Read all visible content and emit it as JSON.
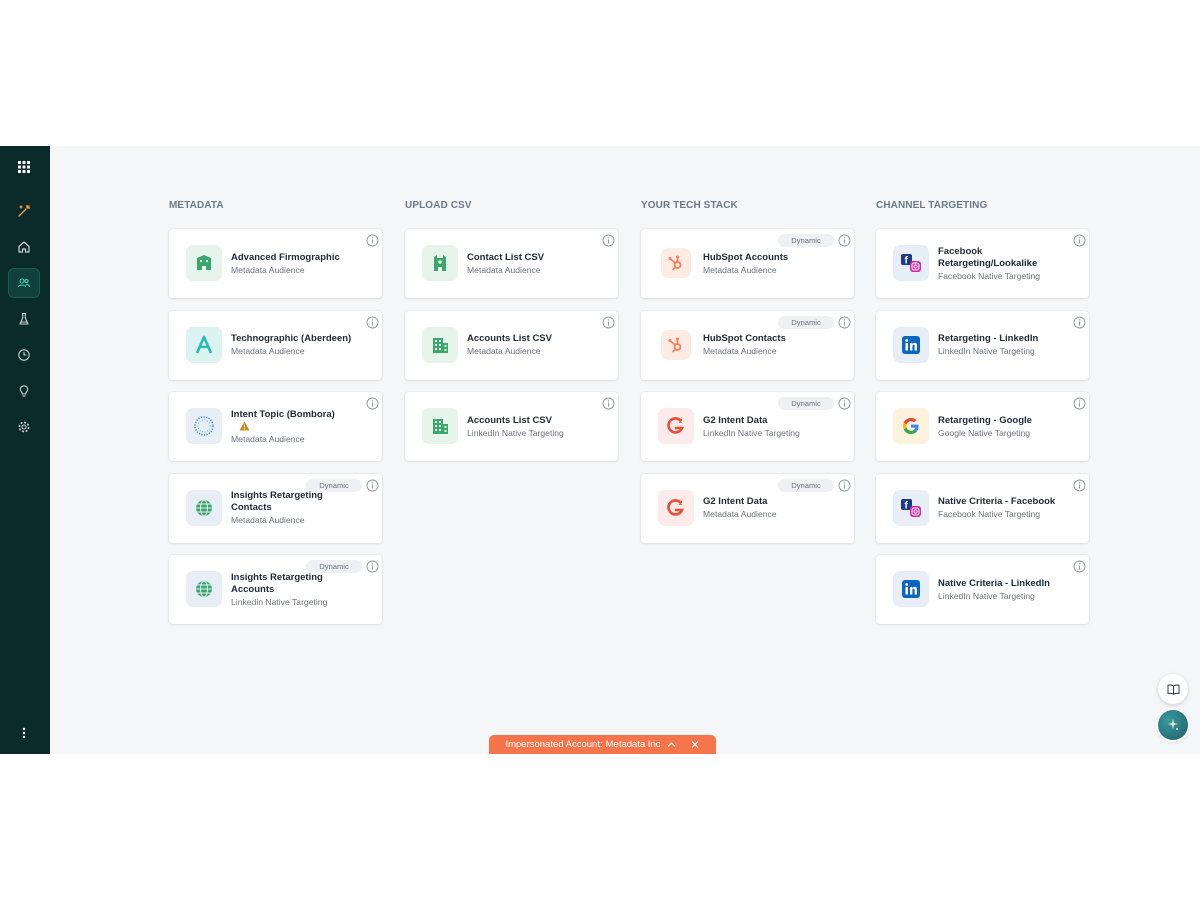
{
  "sidebar": {
    "items": [
      {
        "icon": "apps-grid-icon"
      },
      {
        "icon": "magic-wand-icon"
      },
      {
        "icon": "home-icon"
      },
      {
        "icon": "audience-icon"
      },
      {
        "icon": "flask-icon"
      },
      {
        "icon": "clock-icon"
      },
      {
        "icon": "lightbulb-icon"
      },
      {
        "icon": "settings-icon"
      }
    ],
    "more_icon": "more-vertical-icon"
  },
  "columns": [
    {
      "title": "METADATA",
      "cards": [
        {
          "title": "Advanced Firmographic",
          "subtitle": "Metadata Audience",
          "icon": "building-icon"
        },
        {
          "title": "Technographic (Aberdeen)",
          "subtitle": "Metadata Audience",
          "icon": "aberdeen-logo-icon"
        },
        {
          "title": "Intent Topic (Bombora)",
          "subtitle": "Metadata Audience",
          "icon": "bombora-logo-icon",
          "warning": true
        },
        {
          "title": "Insights Retargeting Contacts",
          "subtitle": "Metadata Audience",
          "icon": "globe-icon",
          "dynamic": "Dynamic"
        },
        {
          "title": "Insights Retargeting Accounts",
          "subtitle": "Linkedin Native Targeting",
          "icon": "globe-icon",
          "dynamic": "Dynamic"
        }
      ]
    },
    {
      "title": "UPLOAD CSV",
      "cards": [
        {
          "title": "Contact List CSV",
          "subtitle": "Metadata Audience",
          "icon": "contact-building-icon"
        },
        {
          "title": "Accounts List CSV",
          "subtitle": "Metadata Audience",
          "icon": "office-building-icon"
        },
        {
          "title": "Accounts List CSV",
          "subtitle": "LinkedIn Native Targeting",
          "icon": "office-building-icon"
        }
      ]
    },
    {
      "title": "YOUR TECH STACK",
      "cards": [
        {
          "title": "HubSpot Accounts",
          "subtitle": "Metadata Audience",
          "icon": "hubspot-logo-icon",
          "dynamic": "Dynamic"
        },
        {
          "title": "HubSpot Contacts",
          "subtitle": "Metadata Audience",
          "icon": "hubspot-logo-icon",
          "dynamic": "Dynamic"
        },
        {
          "title": "G2 Intent Data",
          "subtitle": "LinkedIn Native Targeting",
          "icon": "g2-logo-icon",
          "dynamic": "Dynamic"
        },
        {
          "title": "G2 Intent Data",
          "subtitle": "Metadata Audience",
          "icon": "g2-logo-icon",
          "dynamic": "Dynamic"
        }
      ]
    },
    {
      "title": "CHANNEL TARGETING",
      "cards": [
        {
          "title": "Facebook Retargeting/Lookalike",
          "subtitle": "Facebook Native Targeting",
          "icon": "facebook-instagram-icon"
        },
        {
          "title": "Retargeting - LinkedIn",
          "subtitle": "LinkedIn Native Targeting",
          "icon": "linkedin-logo-icon"
        },
        {
          "title": "Retargeting - Google",
          "subtitle": "Google Native Targeting",
          "icon": "google-logo-icon"
        },
        {
          "title": "Native Criteria - Facebook",
          "subtitle": "Facebook Native Targeting",
          "icon": "facebook-instagram-icon"
        },
        {
          "title": "Native Criteria - LinkedIn",
          "subtitle": "LinkedIn Native Targeting",
          "icon": "linkedin-logo-icon"
        }
      ]
    }
  ],
  "banner": {
    "label": "Impersonated Account:",
    "account": "Metadata Inc"
  },
  "colors": {
    "sidebar_bg": "#0b2b2a",
    "banner_bg": "#f4754b",
    "hubspot": "#ff7a59",
    "g2": "#ef4a34",
    "linkedin": "#0a66c2",
    "green": "#3aa76d"
  }
}
